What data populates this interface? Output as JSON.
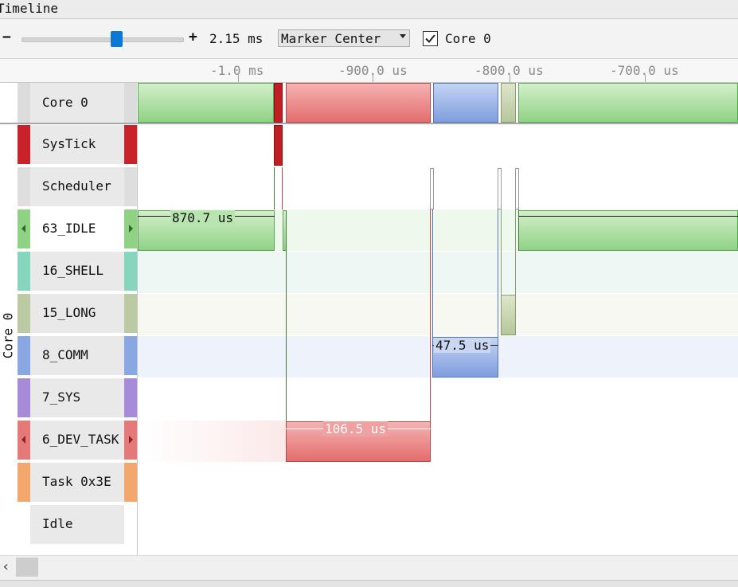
{
  "window": {
    "title": "Timeline"
  },
  "toolbar": {
    "zoom_out": "−",
    "zoom_in": "+",
    "zoom_value": "2.15 ms",
    "zoom_level": 0.6,
    "mode_select": "Marker Center",
    "core_checkbox": {
      "checked": true,
      "label": "Core 0"
    }
  },
  "ruler": {
    "ticks": [
      "-1.0 ms",
      "-900.0 us",
      "-800.0 us",
      "-700.0 us"
    ]
  },
  "core_label": "Core 0",
  "side_label": "Core 0",
  "rows": [
    {
      "label": "SysTick",
      "color": "#c8222a",
      "selected": false
    },
    {
      "label": "Scheduler",
      "color": "#dcdcdc",
      "selected": false
    },
    {
      "label": "63_IDLE",
      "color": "#8fd284",
      "selected": true
    },
    {
      "label": "16_SHELL",
      "color": "#86d6bd",
      "selected": false
    },
    {
      "label": "15_LONG",
      "color": "#bccaa4",
      "selected": false
    },
    {
      "label": "8_COMM",
      "color": "#89a8e3",
      "selected": false
    },
    {
      "label": "7_SYS",
      "color": "#a78ad8",
      "selected": false
    },
    {
      "label": "6_DEV_TASK",
      "color": "#e57979",
      "selected": true
    },
    {
      "label": "Task 0x3E",
      "color": "#f4a76d",
      "selected": false
    },
    {
      "label": "Idle",
      "color": "#ffffff",
      "selected": false
    }
  ],
  "durations": {
    "idle": "870.7 us",
    "comm": "47.5 us",
    "dev_task": "106.5 us"
  },
  "colors": {
    "green": "#8fd284",
    "red": "#e36d6d",
    "blue": "#7f9edf",
    "olive": "#b6c69b",
    "systick": "#bf1e22",
    "accent": "#0a78d7"
  }
}
